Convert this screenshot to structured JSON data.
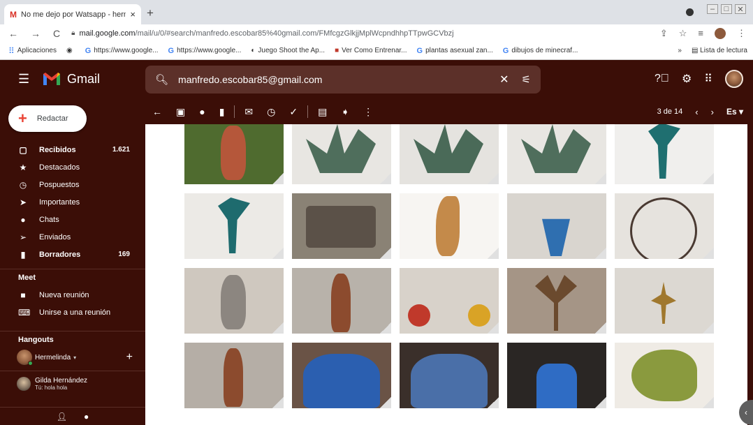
{
  "browser": {
    "tab_title": "No me dejo por Watsapp - herm",
    "tab_close": "×",
    "new_tab": "+",
    "url_host": "mail.google.com",
    "url_path": "/mail/u/0/#search/manfredo.escobar85%40gmail.com/FMfcgzGlkjjMplWcpndhhpTTpwGCVbzj",
    "bookmarks": [
      {
        "icon": "apps-icon",
        "label": "Aplicaciones"
      },
      {
        "icon": "chrome-icon",
        "label": ""
      },
      {
        "icon": "google-icon",
        "label": "https://www.google..."
      },
      {
        "icon": "google-icon",
        "label": "https://www.google..."
      },
      {
        "icon": "game-icon",
        "label": "Juego Shoot the Ap..."
      },
      {
        "icon": "site-icon",
        "label": "Ver Como Entrenar..."
      },
      {
        "icon": "google-icon",
        "label": "plantas asexual zan..."
      },
      {
        "icon": "google-icon",
        "label": "dibujos de minecraf..."
      }
    ],
    "bookmarks_more": "»",
    "reading_list": "Lista de lectura"
  },
  "header": {
    "app_name": "Gmail",
    "search_query": "manfredo.escobar85@gmail.com"
  },
  "sidebar": {
    "compose_label": "Redactar",
    "items": [
      {
        "icon": "inbox-icon",
        "label": "Recibidos",
        "count": "1.621",
        "bold": true
      },
      {
        "icon": "star-icon",
        "label": "Destacados",
        "count": "",
        "bold": false
      },
      {
        "icon": "clock-icon",
        "label": "Pospuestos",
        "count": "",
        "bold": false
      },
      {
        "icon": "important-icon",
        "label": "Importantes",
        "count": "",
        "bold": false
      },
      {
        "icon": "chat-icon",
        "label": "Chats",
        "count": "",
        "bold": false
      },
      {
        "icon": "send-icon",
        "label": "Enviados",
        "count": "",
        "bold": false
      },
      {
        "icon": "draft-icon",
        "label": "Borradores",
        "count": "169",
        "bold": true
      }
    ],
    "meet_title": "Meet",
    "meet_items": [
      {
        "icon": "video-icon",
        "label": "Nueva reunión"
      },
      {
        "icon": "keyboard-icon",
        "label": "Unirse a una reunión"
      }
    ],
    "hangouts_title": "Hangouts",
    "hangouts_user": "Hermelinda",
    "hangouts_contact_name": "Gilda Hernández",
    "hangouts_contact_msg": "Tú: hola hola"
  },
  "action_bar": {
    "pager_text": "3 de 14",
    "lang": "Es"
  },
  "colors": {
    "theme_bg": "#3b0e07",
    "search_bg": "#5c3029",
    "content_bg": "#ffffff"
  },
  "thumbnails": [
    {
      "name": "sculpture-red-torso",
      "bg": "#4f6b2f",
      "fig": "#b5573a"
    },
    {
      "name": "sculpture-green-abstract-1",
      "bg": "#e8e6e2",
      "fig": "#4f6e5c"
    },
    {
      "name": "sculpture-green-abstract-2",
      "bg": "#e5e3df",
      "fig": "#4a6a58"
    },
    {
      "name": "sculpture-green-abstract-3",
      "bg": "#e8e6e2",
      "fig": "#4f6e5c"
    },
    {
      "name": "sculpture-winged-teal-1",
      "bg": "#f0efed",
      "fig": "#1f6f70"
    },
    {
      "name": "sculpture-winged-teal-2",
      "bg": "#eceae6",
      "fig": "#1e6b6e"
    },
    {
      "name": "sculpture-metal-box",
      "bg": "#8a8275",
      "fig": "#5b5148"
    },
    {
      "name": "sculpture-wood-form",
      "bg": "#f7f5f2",
      "fig": "#c48a4a"
    },
    {
      "name": "sculpture-flame-vase",
      "bg": "#d9d5cf",
      "fig": "#2f6fb0"
    },
    {
      "name": "sculpture-ballerina-wheel",
      "bg": "#e6e3de",
      "fig": "#4a3a32"
    },
    {
      "name": "sculpture-metal-torso",
      "bg": "#cfc8bf",
      "fig": "#8c8680"
    },
    {
      "name": "sculpture-bronze-figure-1",
      "bg": "#b8b2aa",
      "fig": "#8c4b2e"
    },
    {
      "name": "sculpture-tightrope-balls",
      "bg": "#d8d2ca",
      "fig": "#c0392b"
    },
    {
      "name": "sculpture-tree",
      "bg": "#a59586",
      "fig": "#6b4a2e"
    },
    {
      "name": "sculpture-ballerina-bronze",
      "bg": "#dcd8d2",
      "fig": "#a0782e"
    },
    {
      "name": "sculpture-bronze-figure-2",
      "bg": "#b5aea6",
      "fig": "#8c4b2e"
    },
    {
      "name": "sculpture-blue-mesh",
      "bg": "#6a5346",
      "fig": "#2b5fb0"
    },
    {
      "name": "sculpture-chainmail",
      "bg": "#3a2f2a",
      "fig": "#4a6fa8"
    },
    {
      "name": "photo-man-blue-shirt",
      "bg": "#2a2624",
      "fig": "#2f6cc4"
    },
    {
      "name": "sculpture-winged-horse",
      "bg": "#efebe5",
      "fig": "#8a9a3e"
    }
  ]
}
